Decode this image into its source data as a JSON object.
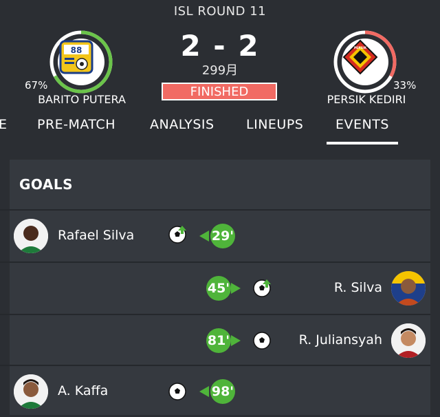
{
  "match": {
    "round": "ISL ROUND 11",
    "score": "2 - 2",
    "date": "299月",
    "status": "FINISHED"
  },
  "home": {
    "name": "BARITO PUTERA",
    "pct": "67%",
    "pct_value": 67,
    "logo_text": "88",
    "color": "#6bc44a"
  },
  "away": {
    "name": "PERSIK KEDIRI",
    "pct": "33%",
    "pct_value": 33,
    "logo_text": "PERSIK",
    "color": "#f16a63"
  },
  "tabs": [
    "E",
    "PRE-MATCH",
    "ANALYSIS",
    "LINEUPS",
    "EVENTS"
  ],
  "active_tab": "EVENTS",
  "goals_title": "GOALS",
  "goals": [
    {
      "side": "home",
      "player": "Rafael Silva",
      "minute": "29'",
      "icon": "goal-ball-icon"
    },
    {
      "side": "away",
      "player": "R. Silva",
      "minute": "45'",
      "icon": "goal-ball-icon"
    },
    {
      "side": "away",
      "player": "R. Juliansyah",
      "minute": "81'",
      "icon": "ball-icon"
    },
    {
      "side": "home",
      "player": "A. Kaffa",
      "minute": "98'",
      "icon": "ball-icon"
    }
  ],
  "colors": {
    "accent_green": "#4fb43a",
    "status_red": "#f16a63",
    "background": "#2b2e33",
    "panel": "#35393f"
  }
}
